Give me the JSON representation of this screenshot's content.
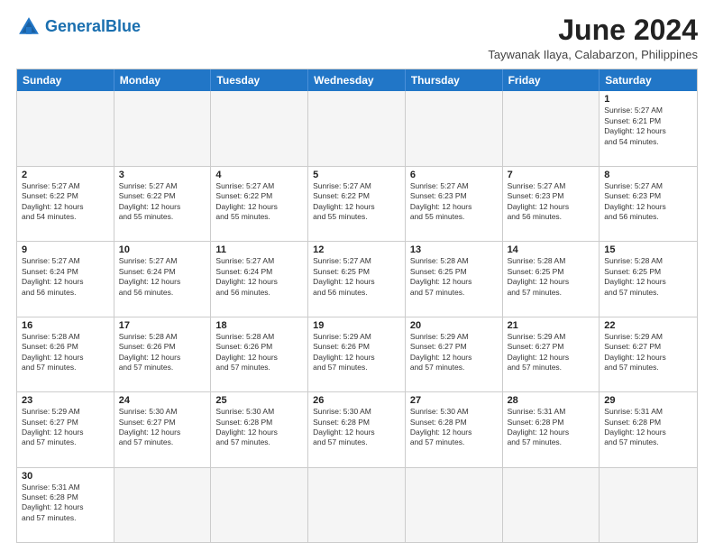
{
  "header": {
    "logo_general": "General",
    "logo_blue": "Blue",
    "month_year": "June 2024",
    "location": "Taywanak Ilaya, Calabarzon, Philippines"
  },
  "weekdays": [
    "Sunday",
    "Monday",
    "Tuesday",
    "Wednesday",
    "Thursday",
    "Friday",
    "Saturday"
  ],
  "rows": [
    [
      {
        "day": "",
        "info": "",
        "empty": true
      },
      {
        "day": "",
        "info": "",
        "empty": true
      },
      {
        "day": "",
        "info": "",
        "empty": true
      },
      {
        "day": "",
        "info": "",
        "empty": true
      },
      {
        "day": "",
        "info": "",
        "empty": true
      },
      {
        "day": "",
        "info": "",
        "empty": true
      },
      {
        "day": "1",
        "info": "Sunrise: 5:27 AM\nSunset: 6:21 PM\nDaylight: 12 hours\nand 54 minutes.",
        "empty": false
      }
    ],
    [
      {
        "day": "2",
        "info": "Sunrise: 5:27 AM\nSunset: 6:22 PM\nDaylight: 12 hours\nand 54 minutes.",
        "empty": false
      },
      {
        "day": "3",
        "info": "Sunrise: 5:27 AM\nSunset: 6:22 PM\nDaylight: 12 hours\nand 55 minutes.",
        "empty": false
      },
      {
        "day": "4",
        "info": "Sunrise: 5:27 AM\nSunset: 6:22 PM\nDaylight: 12 hours\nand 55 minutes.",
        "empty": false
      },
      {
        "day": "5",
        "info": "Sunrise: 5:27 AM\nSunset: 6:22 PM\nDaylight: 12 hours\nand 55 minutes.",
        "empty": false
      },
      {
        "day": "6",
        "info": "Sunrise: 5:27 AM\nSunset: 6:23 PM\nDaylight: 12 hours\nand 55 minutes.",
        "empty": false
      },
      {
        "day": "7",
        "info": "Sunrise: 5:27 AM\nSunset: 6:23 PM\nDaylight: 12 hours\nand 56 minutes.",
        "empty": false
      },
      {
        "day": "8",
        "info": "Sunrise: 5:27 AM\nSunset: 6:23 PM\nDaylight: 12 hours\nand 56 minutes.",
        "empty": false
      }
    ],
    [
      {
        "day": "9",
        "info": "Sunrise: 5:27 AM\nSunset: 6:24 PM\nDaylight: 12 hours\nand 56 minutes.",
        "empty": false
      },
      {
        "day": "10",
        "info": "Sunrise: 5:27 AM\nSunset: 6:24 PM\nDaylight: 12 hours\nand 56 minutes.",
        "empty": false
      },
      {
        "day": "11",
        "info": "Sunrise: 5:27 AM\nSunset: 6:24 PM\nDaylight: 12 hours\nand 56 minutes.",
        "empty": false
      },
      {
        "day": "12",
        "info": "Sunrise: 5:27 AM\nSunset: 6:25 PM\nDaylight: 12 hours\nand 56 minutes.",
        "empty": false
      },
      {
        "day": "13",
        "info": "Sunrise: 5:28 AM\nSunset: 6:25 PM\nDaylight: 12 hours\nand 57 minutes.",
        "empty": false
      },
      {
        "day": "14",
        "info": "Sunrise: 5:28 AM\nSunset: 6:25 PM\nDaylight: 12 hours\nand 57 minutes.",
        "empty": false
      },
      {
        "day": "15",
        "info": "Sunrise: 5:28 AM\nSunset: 6:25 PM\nDaylight: 12 hours\nand 57 minutes.",
        "empty": false
      }
    ],
    [
      {
        "day": "16",
        "info": "Sunrise: 5:28 AM\nSunset: 6:26 PM\nDaylight: 12 hours\nand 57 minutes.",
        "empty": false
      },
      {
        "day": "17",
        "info": "Sunrise: 5:28 AM\nSunset: 6:26 PM\nDaylight: 12 hours\nand 57 minutes.",
        "empty": false
      },
      {
        "day": "18",
        "info": "Sunrise: 5:28 AM\nSunset: 6:26 PM\nDaylight: 12 hours\nand 57 minutes.",
        "empty": false
      },
      {
        "day": "19",
        "info": "Sunrise: 5:29 AM\nSunset: 6:26 PM\nDaylight: 12 hours\nand 57 minutes.",
        "empty": false
      },
      {
        "day": "20",
        "info": "Sunrise: 5:29 AM\nSunset: 6:27 PM\nDaylight: 12 hours\nand 57 minutes.",
        "empty": false
      },
      {
        "day": "21",
        "info": "Sunrise: 5:29 AM\nSunset: 6:27 PM\nDaylight: 12 hours\nand 57 minutes.",
        "empty": false
      },
      {
        "day": "22",
        "info": "Sunrise: 5:29 AM\nSunset: 6:27 PM\nDaylight: 12 hours\nand 57 minutes.",
        "empty": false
      }
    ],
    [
      {
        "day": "23",
        "info": "Sunrise: 5:29 AM\nSunset: 6:27 PM\nDaylight: 12 hours\nand 57 minutes.",
        "empty": false
      },
      {
        "day": "24",
        "info": "Sunrise: 5:30 AM\nSunset: 6:27 PM\nDaylight: 12 hours\nand 57 minutes.",
        "empty": false
      },
      {
        "day": "25",
        "info": "Sunrise: 5:30 AM\nSunset: 6:28 PM\nDaylight: 12 hours\nand 57 minutes.",
        "empty": false
      },
      {
        "day": "26",
        "info": "Sunrise: 5:30 AM\nSunset: 6:28 PM\nDaylight: 12 hours\nand 57 minutes.",
        "empty": false
      },
      {
        "day": "27",
        "info": "Sunrise: 5:30 AM\nSunset: 6:28 PM\nDaylight: 12 hours\nand 57 minutes.",
        "empty": false
      },
      {
        "day": "28",
        "info": "Sunrise: 5:31 AM\nSunset: 6:28 PM\nDaylight: 12 hours\nand 57 minutes.",
        "empty": false
      },
      {
        "day": "29",
        "info": "Sunrise: 5:31 AM\nSunset: 6:28 PM\nDaylight: 12 hours\nand 57 minutes.",
        "empty": false
      }
    ],
    [
      {
        "day": "30",
        "info": "Sunrise: 5:31 AM\nSunset: 6:28 PM\nDaylight: 12 hours\nand 57 minutes.",
        "empty": false
      },
      {
        "day": "",
        "info": "",
        "empty": true
      },
      {
        "day": "",
        "info": "",
        "empty": true
      },
      {
        "day": "",
        "info": "",
        "empty": true
      },
      {
        "day": "",
        "info": "",
        "empty": true
      },
      {
        "day": "",
        "info": "",
        "empty": true
      },
      {
        "day": "",
        "info": "",
        "empty": true
      }
    ]
  ]
}
